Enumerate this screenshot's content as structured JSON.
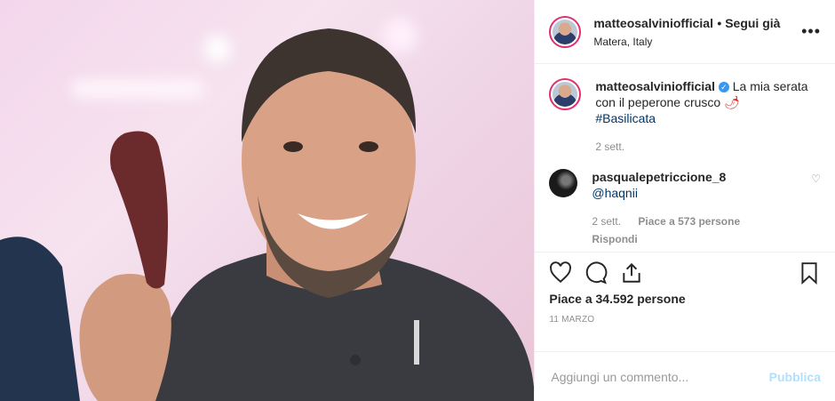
{
  "header": {
    "username": "matteosalviniofficial",
    "follow_status": "• Segui già",
    "location": "Matera, Italy",
    "more_icon": "more-dots-icon"
  },
  "caption": {
    "username": "matteosalviniofficial",
    "text": "La mia serata con il peperone crusco",
    "emoji": "🌶",
    "hashtag": "#Basilicata",
    "time": "2 sett."
  },
  "comment": {
    "username": "pasqualepetriccione_8",
    "mention": "@haqnii",
    "time": "2 sett.",
    "likes": "Piace a 573 persone",
    "reply": "Rispondi"
  },
  "post": {
    "likes": "Piace a 34.592 persone",
    "date": "11 MARZO"
  },
  "add_comment": {
    "placeholder": "Aggiungi un commento...",
    "publish": "Pubblica"
  }
}
